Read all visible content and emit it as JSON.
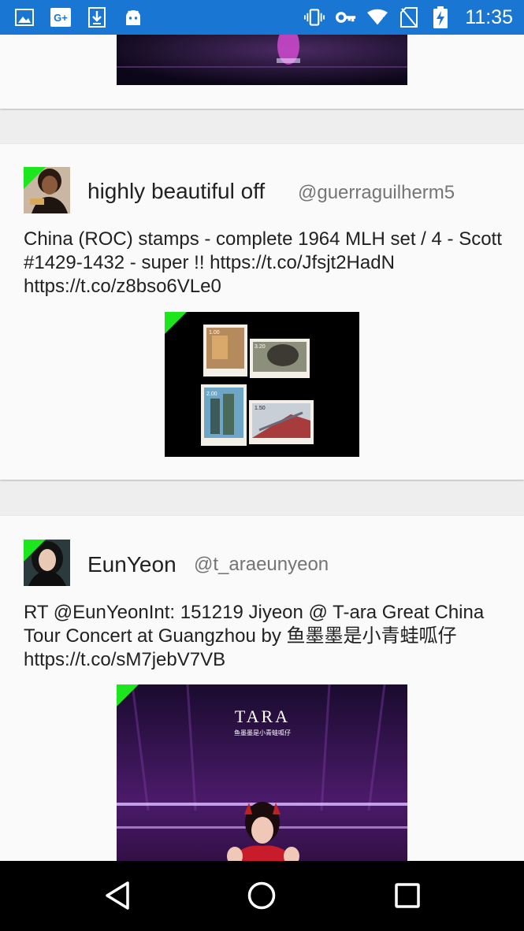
{
  "status_bar": {
    "time": "11:35",
    "left_icons": [
      "image-icon",
      "google-plus-icon",
      "download-icon",
      "android-icon"
    ],
    "right_icons": [
      "vibrate-icon",
      "key-icon",
      "wifi-icon",
      "no-sim-icon",
      "battery-charging-icon"
    ],
    "background": "#1976d2",
    "gplus_label": "G+"
  },
  "tweets": [
    {
      "name": "highly beautiful off",
      "handle": "@guerraguilherm5",
      "text": "China (ROC) stamps - complete 1964 MLH set / 4 - Scott #1429-1432 - super !! https://t.co/Jfsjt2HadN https://t.co/z8bso6VLe0",
      "stamps": [
        "1.00",
        "3.20",
        "2.00",
        "1.50"
      ]
    },
    {
      "name": "EunYeon",
      "handle": "@t_araeunyeon",
      "text": "RT @EunYeonInt: 151219 Jiyeon @ T-ara Great China Tour Concert at Guangzhou by 鱼墨墨是小青蛙呱仔 https://t.co/sM7jebV7VB",
      "media_title": "TARA",
      "media_subtitle": "鱼墨墨是小青蛙呱仔"
    }
  ],
  "nav_bar": {
    "icons": [
      "back-icon",
      "home-icon",
      "recents-icon"
    ]
  },
  "colors": {
    "accent_corner": "#1ee61e",
    "card": "#fafafa",
    "background": "#eeeeee"
  }
}
